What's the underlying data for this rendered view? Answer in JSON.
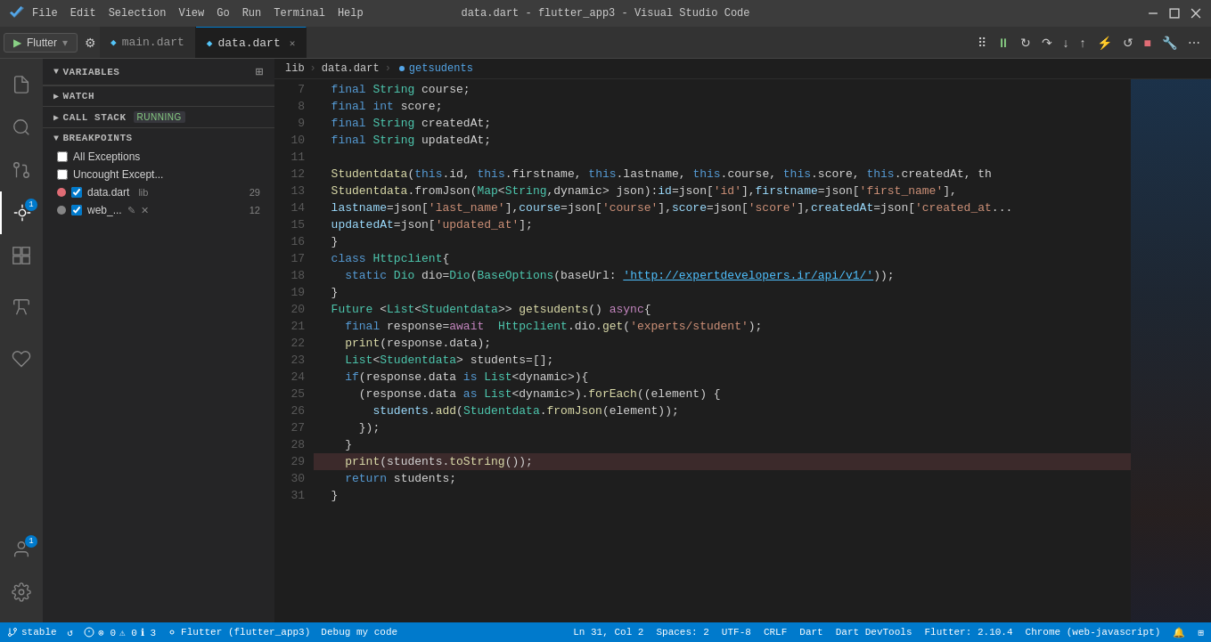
{
  "titleBar": {
    "title": "data.dart - flutter_app3 - Visual Studio Code",
    "menus": [
      "File",
      "Edit",
      "Selection",
      "View",
      "Go",
      "Run",
      "Terminal",
      "Help"
    ],
    "controls": [
      "⬜",
      "❐",
      "✕"
    ]
  },
  "debugToolbar": {
    "flutter_label": "Flutter",
    "settings_icon": "⚙",
    "pause_icon": "⏸",
    "continue_icon": "▶",
    "step_over_icon": "↷",
    "step_into_icon": "↓",
    "step_out_icon": "↑",
    "restart_icon": "⟳",
    "stop_icon": "■",
    "hot_reload_icon": "⚡",
    "hot_restart_icon": "↺",
    "open_devtools": "🔧",
    "more_icon": "⋯"
  },
  "tabs": [
    {
      "name": "main.dart",
      "active": false,
      "icon": "dart",
      "closable": false
    },
    {
      "name": "data.dart",
      "active": true,
      "icon": "dart",
      "closable": true
    }
  ],
  "breadcrumb": {
    "items": [
      "lib",
      "data.dart",
      "getsudents"
    ]
  },
  "sidebar": {
    "variables_label": "VARIABLES",
    "watch_label": "WATCH",
    "callstack_label": "CALL STACK",
    "callstack_status": "RUNNING",
    "breakpoints_label": "BREAKPOINTS",
    "breakpoints": [
      {
        "label": "All Exceptions",
        "checked": false,
        "dot": null
      },
      {
        "label": "Uncought Except...",
        "checked": false,
        "dot": null
      },
      {
        "label": "data.dart",
        "lib": "lib",
        "line": "29",
        "checked": true,
        "dot": "red"
      },
      {
        "label": "web_...",
        "line": "12",
        "checked": true,
        "dot": "gray",
        "edit": true,
        "close": true
      }
    ]
  },
  "editor": {
    "lines": [
      {
        "num": 7,
        "code": [
          {
            "t": "  ",
            "c": ""
          },
          {
            "t": "final",
            "c": "kw"
          },
          {
            "t": " ",
            "c": ""
          },
          {
            "t": "String",
            "c": "cls"
          },
          {
            "t": " course;",
            "c": ""
          }
        ]
      },
      {
        "num": 8,
        "code": [
          {
            "t": "  ",
            "c": ""
          },
          {
            "t": "final",
            "c": "kw"
          },
          {
            "t": " ",
            "c": ""
          },
          {
            "t": "int",
            "c": "kw"
          },
          {
            "t": " score;",
            "c": ""
          }
        ]
      },
      {
        "num": 9,
        "code": [
          {
            "t": "  ",
            "c": ""
          },
          {
            "t": "final",
            "c": "kw"
          },
          {
            "t": " ",
            "c": ""
          },
          {
            "t": "String",
            "c": "cls"
          },
          {
            "t": " createdAt;",
            "c": ""
          }
        ]
      },
      {
        "num": 10,
        "code": [
          {
            "t": "  ",
            "c": ""
          },
          {
            "t": "final",
            "c": "kw"
          },
          {
            "t": " ",
            "c": ""
          },
          {
            "t": "String",
            "c": "cls"
          },
          {
            "t": " updatedAt;",
            "c": ""
          }
        ]
      },
      {
        "num": 11,
        "code": []
      },
      {
        "num": 12,
        "code": [
          {
            "t": "  ",
            "c": ""
          },
          {
            "t": "Studentdata",
            "c": "fn"
          },
          {
            "t": "(",
            "c": ""
          },
          {
            "t": "this",
            "c": "kw"
          },
          {
            "t": ".id, ",
            "c": ""
          },
          {
            "t": "this",
            "c": "kw"
          },
          {
            "t": ".firstname, ",
            "c": ""
          },
          {
            "t": "this",
            "c": "kw"
          },
          {
            "t": ".lastname, ",
            "c": ""
          },
          {
            "t": "this",
            "c": "kw"
          },
          {
            "t": ".course, ",
            "c": ""
          },
          {
            "t": "this",
            "c": "kw"
          },
          {
            "t": ".score, ",
            "c": ""
          },
          {
            "t": "this",
            "c": "kw"
          },
          {
            "t": ".createdAt, th",
            "c": ""
          }
        ]
      },
      {
        "num": 13,
        "code": [
          {
            "t": "  ",
            "c": ""
          },
          {
            "t": "Studentdata",
            "c": "fn"
          },
          {
            "t": ".fromJson(",
            "c": ""
          },
          {
            "t": "Map",
            "c": "cls"
          },
          {
            "t": "<",
            "c": ""
          },
          {
            "t": "String",
            "c": "cls"
          },
          {
            "t": ",dynamic> json):",
            "c": ""
          },
          {
            "t": "id",
            "c": "var"
          },
          {
            "t": "=json[",
            "c": ""
          },
          {
            "t": "'id'",
            "c": "str"
          },
          {
            "t": "],",
            "c": ""
          },
          {
            "t": "firstname",
            "c": "var"
          },
          {
            "t": "=json[",
            "c": ""
          },
          {
            "t": "'first_name'",
            "c": "str"
          },
          {
            "t": "],",
            "c": ""
          }
        ]
      },
      {
        "num": 14,
        "code": [
          {
            "t": "  ",
            "c": ""
          },
          {
            "t": "lastname",
            "c": "var"
          },
          {
            "t": "=json[",
            "c": ""
          },
          {
            "t": "'last_name'",
            "c": "str"
          },
          {
            "t": "],",
            "c": ""
          },
          {
            "t": "course",
            "c": "var"
          },
          {
            "t": "=json[",
            "c": ""
          },
          {
            "t": "'course'",
            "c": "str"
          },
          {
            "t": "],",
            "c": ""
          },
          {
            "t": "score",
            "c": "var"
          },
          {
            "t": "=json[",
            "c": ""
          },
          {
            "t": "'score'",
            "c": "str"
          },
          {
            "t": "],",
            "c": ""
          },
          {
            "t": "createdAt",
            "c": "var"
          },
          {
            "t": "=json[",
            "c": ""
          },
          {
            "t": "'created_at",
            "c": "str"
          },
          {
            "t": "...",
            "c": ""
          }
        ]
      },
      {
        "num": 15,
        "code": [
          {
            "t": "  ",
            "c": ""
          },
          {
            "t": "updatedAt",
            "c": "var"
          },
          {
            "t": "=json[",
            "c": ""
          },
          {
            "t": "'updated_at'",
            "c": "str"
          },
          {
            "t": "];",
            "c": ""
          }
        ]
      },
      {
        "num": 16,
        "code": [
          {
            "t": "  }",
            "c": ""
          }
        ]
      },
      {
        "num": 17,
        "code": [
          {
            "t": "  ",
            "c": ""
          },
          {
            "t": "class",
            "c": "kw"
          },
          {
            "t": " ",
            "c": ""
          },
          {
            "t": "Httpclient",
            "c": "cls"
          },
          {
            "t": "{",
            "c": ""
          }
        ]
      },
      {
        "num": 18,
        "code": [
          {
            "t": "    ",
            "c": ""
          },
          {
            "t": "static",
            "c": "kw"
          },
          {
            "t": " ",
            "c": ""
          },
          {
            "t": "Dio",
            "c": "cls"
          },
          {
            "t": " dio=",
            "c": ""
          },
          {
            "t": "Dio",
            "c": "cls"
          },
          {
            "t": "(",
            "c": ""
          },
          {
            "t": "BaseOptions",
            "c": "cls"
          },
          {
            "t": "(baseUrl: ",
            "c": ""
          },
          {
            "t": "'http://expertdevelopers.ir/api/v1/'",
            "c": "url-link"
          },
          {
            "t": "));",
            "c": ""
          }
        ]
      },
      {
        "num": 19,
        "code": [
          {
            "t": "  }",
            "c": ""
          }
        ]
      },
      {
        "num": 20,
        "code": [
          {
            "t": "  ",
            "c": ""
          },
          {
            "t": "Future",
            "c": "cls"
          },
          {
            "t": " <",
            "c": ""
          },
          {
            "t": "List",
            "c": "cls"
          },
          {
            "t": "<",
            "c": ""
          },
          {
            "t": "Studentdata",
            "c": "cls"
          },
          {
            "t": ">> ",
            "c": ""
          },
          {
            "t": "getsudents",
            "c": "fn"
          },
          {
            "t": "() ",
            "c": ""
          },
          {
            "t": "async",
            "c": "kw2"
          },
          {
            "t": "{",
            "c": ""
          }
        ]
      },
      {
        "num": 21,
        "code": [
          {
            "t": "    ",
            "c": ""
          },
          {
            "t": "final",
            "c": "kw"
          },
          {
            "t": " response=",
            "c": ""
          },
          {
            "t": "await",
            "c": "kw2"
          },
          {
            "t": "  ",
            "c": ""
          },
          {
            "t": "Httpclient",
            "c": "cls"
          },
          {
            "t": ".dio.",
            "c": ""
          },
          {
            "t": "get",
            "c": "fn"
          },
          {
            "t": "(",
            "c": ""
          },
          {
            "t": "'experts/student'",
            "c": "str"
          },
          {
            "t": ");",
            "c": ""
          }
        ]
      },
      {
        "num": 22,
        "code": [
          {
            "t": "    ",
            "c": ""
          },
          {
            "t": "print",
            "c": "fn"
          },
          {
            "t": "(response.data);",
            "c": ""
          }
        ]
      },
      {
        "num": 23,
        "code": [
          {
            "t": "    ",
            "c": ""
          },
          {
            "t": "List",
            "c": "cls"
          },
          {
            "t": "<",
            "c": ""
          },
          {
            "t": "Studentdata",
            "c": "cls"
          },
          {
            "t": "> students=[];",
            "c": ""
          }
        ]
      },
      {
        "num": 24,
        "code": [
          {
            "t": "    ",
            "c": ""
          },
          {
            "t": "if",
            "c": "kw"
          },
          {
            "t": "(response.data ",
            "c": ""
          },
          {
            "t": "is",
            "c": "kw"
          },
          {
            "t": " ",
            "c": ""
          },
          {
            "t": "List",
            "c": "cls"
          },
          {
            "t": "<dynamic>){",
            "c": ""
          }
        ]
      },
      {
        "num": 25,
        "code": [
          {
            "t": "      ",
            "c": ""
          },
          {
            "t": "(response.data ",
            "c": ""
          },
          {
            "t": "as",
            "c": "kw"
          },
          {
            "t": " ",
            "c": ""
          },
          {
            "t": "List",
            "c": "cls"
          },
          {
            "t": "<dynamic>).",
            "c": ""
          },
          {
            "t": "forEach",
            "c": "fn"
          },
          {
            "t": "((element) {",
            "c": ""
          }
        ]
      },
      {
        "num": 26,
        "code": [
          {
            "t": "        ",
            "c": ""
          },
          {
            "t": "students",
            "c": "var"
          },
          {
            "t": ".",
            "c": ""
          },
          {
            "t": "add",
            "c": "fn"
          },
          {
            "t": "(",
            "c": ""
          },
          {
            "t": "Studentdata",
            "c": "cls"
          },
          {
            "t": ".",
            "c": ""
          },
          {
            "t": "fromJson",
            "c": "fn"
          },
          {
            "t": "(element));",
            "c": ""
          }
        ]
      },
      {
        "num": 27,
        "code": [
          {
            "t": "      });",
            "c": ""
          }
        ]
      },
      {
        "num": 28,
        "code": [
          {
            "t": "    }",
            "c": ""
          }
        ]
      },
      {
        "num": 29,
        "code": [
          {
            "t": "    ",
            "c": ""
          },
          {
            "t": "print",
            "c": "fn"
          },
          {
            "t": "(students.",
            "c": ""
          },
          {
            "t": "toString",
            "c": "fn"
          },
          {
            "t": "());",
            "c": ""
          }
        ],
        "breakpoint": true
      },
      {
        "num": 30,
        "code": [
          {
            "t": "    ",
            "c": ""
          },
          {
            "t": "return",
            "c": "kw"
          },
          {
            "t": " students;",
            "c": ""
          }
        ]
      },
      {
        "num": 31,
        "code": [
          {
            "t": "  }",
            "c": ""
          }
        ]
      }
    ]
  },
  "statusBar": {
    "branch": "stable",
    "sync": "↺",
    "errors": "⊗ 0",
    "warnings": "⚠ 0",
    "info": "ℹ 3",
    "debug": "Flutter (flutter_app3)",
    "debug_label": "Debug my code",
    "cursor": "Ln 31, Col 2",
    "spaces": "Spaces: 2",
    "encoding": "UTF-8",
    "line_ending": "CRLF",
    "language": "Dart",
    "devtools": "Dart DevTools",
    "flutter_version": "Flutter: 2.10.4",
    "chrome": "Chrome (web-javascript)",
    "notification_icon": "🔔",
    "layout_icon": "⊞"
  }
}
